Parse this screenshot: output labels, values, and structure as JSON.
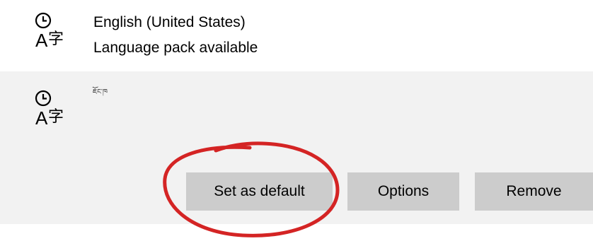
{
  "languages": [
    {
      "name": "English (United States)",
      "status": "Language pack available",
      "icon": "language-pack-icon"
    },
    {
      "name": "ཇོང་ཁ",
      "icon": "language-pack-icon"
    }
  ],
  "buttons": {
    "set_default": "Set as default",
    "options": "Options",
    "remove": "Remove"
  },
  "colors": {
    "selected_row_bg": "#f2f2f2",
    "button_bg": "#cccccc",
    "annotation_circle": "#d42424"
  }
}
